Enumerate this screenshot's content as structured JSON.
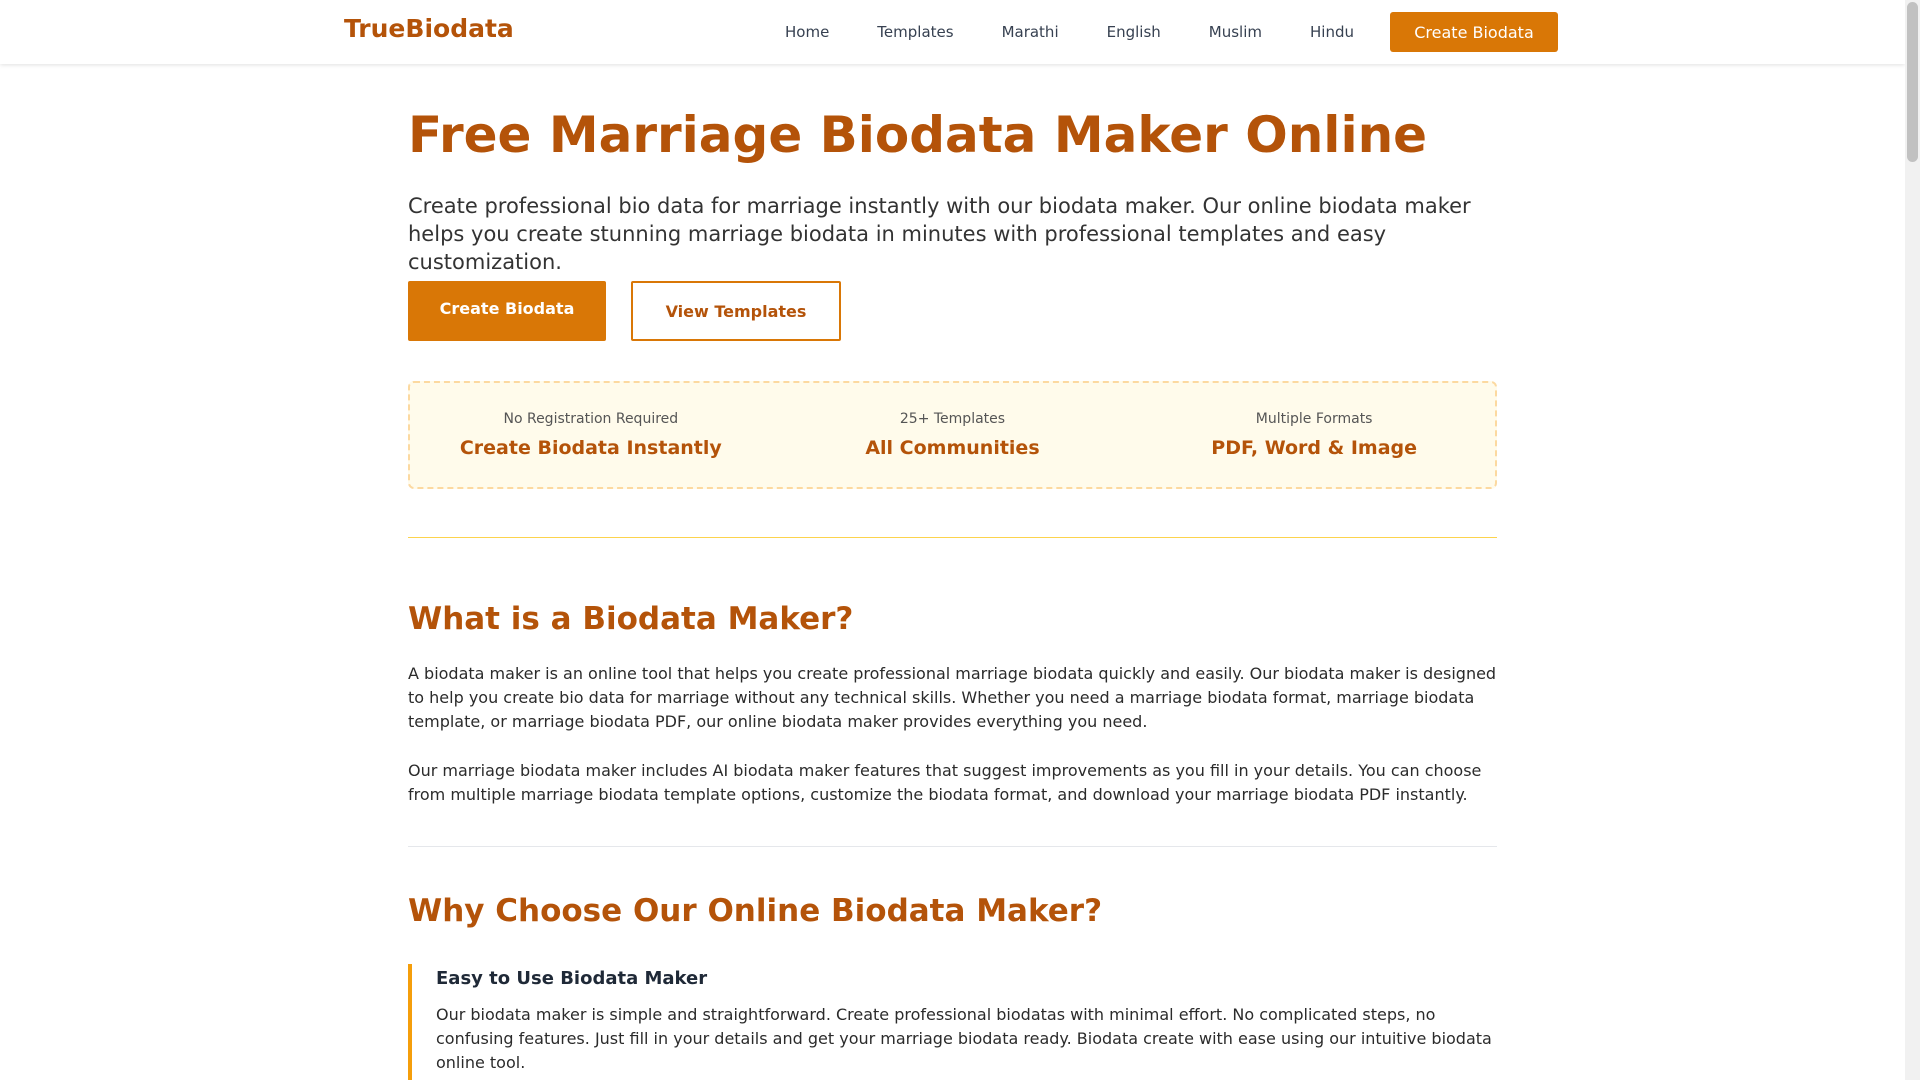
{
  "header": {
    "brand": "TrueBiodata",
    "nav": [
      "Home",
      "Templates",
      "Marathi",
      "English",
      "Muslim",
      "Hindu"
    ],
    "cta": "Create Biodata"
  },
  "hero": {
    "title": "Free Marriage Biodata Maker Online",
    "intro": "Create professional bio data for marriage instantly with our biodata maker. Our online biodata maker helps you create stunning marriage biodata in minutes with professional templates and easy customization.",
    "primary_button": "Create Biodata",
    "secondary_button": "View Templates"
  },
  "features": [
    {
      "sub": "No Registration Required",
      "main": "Create Biodata Instantly"
    },
    {
      "sub": "25+ Templates",
      "main": "All Communities"
    },
    {
      "sub": "Multiple Formats",
      "main": "PDF, Word & Image"
    }
  ],
  "what_is": {
    "heading": "What is a Biodata Maker?",
    "p1": "A biodata maker is an online tool that helps you create professional marriage biodata quickly and easily. Our biodata maker is designed to help you create bio data for marriage without any technical skills. Whether you need a marriage biodata format, marriage biodata template, or marriage biodata PDF, our online biodata maker provides everything you need.",
    "p2": "Our marriage biodata maker includes AI biodata maker features that suggest improvements as you fill in your details. You can choose from multiple marriage biodata template options, customize the biodata format, and download your marriage biodata PDF instantly."
  },
  "why_choose": {
    "heading": "Why Choose Our Online Biodata Maker?",
    "item_title": "Easy to Use Biodata Maker",
    "item_text": "Our biodata maker is simple and straightforward. Create professional biodatas with minimal effort. No complicated steps, no confusing features. Just fill in your details and get your marriage biodata ready. Biodata create with ease using our intuitive biodata online tool."
  },
  "colors": {
    "brand": "#b45309",
    "accent": "#d97706",
    "feature_bg": "#fffbeb"
  }
}
